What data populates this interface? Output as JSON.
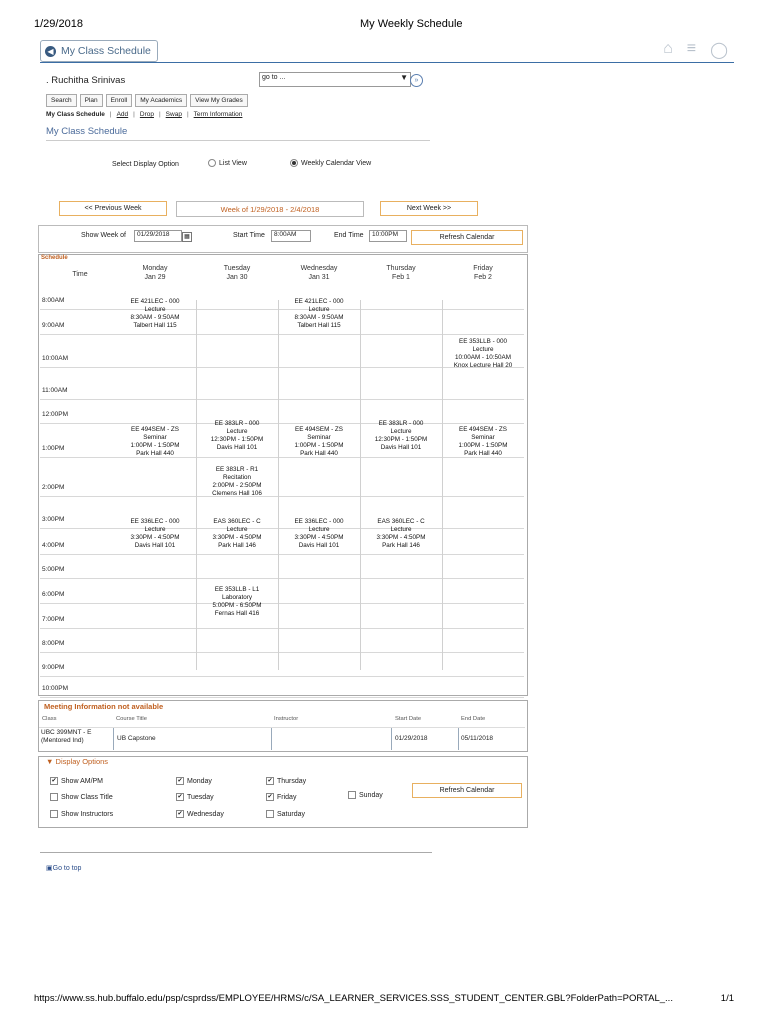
{
  "print_header": {
    "date": "1/29/2018",
    "title": "My Weekly Schedule"
  },
  "back_button": "My Class Schedule",
  "student_name": ". Ruchitha Srinivas",
  "goto": {
    "value": "go to ..."
  },
  "nav_buttons": [
    "Search",
    "Plan",
    "Enroll",
    "My Academics",
    "View My Grades"
  ],
  "sub_nav": [
    "My Class Schedule",
    "Add",
    "Drop",
    "Swap",
    "Term Information"
  ],
  "page_title": "My Class Schedule",
  "display_option": {
    "label": "Select Display Option",
    "list_view": "List View",
    "weekly_view": "Weekly Calendar View",
    "selected": "weekly"
  },
  "week_nav": {
    "prev": "<< Previous Week",
    "current": "Week of 1/29/2018 - 2/4/2018",
    "next": "Next Week >>"
  },
  "controls": {
    "show_week_label": "Show Week of",
    "show_week_value": "01/29/2018",
    "start_label": "Start Time",
    "start_value": "8:00AM",
    "end_label": "End Time",
    "end_value": "10:00PM",
    "refresh": "Refresh Calendar"
  },
  "schedule": {
    "label": "Schedule",
    "time_header": "Time",
    "days": [
      {
        "name": "Monday",
        "date": "Jan 29"
      },
      {
        "name": "Tuesday",
        "date": "Jan 30"
      },
      {
        "name": "Wednesday",
        "date": "Jan 31"
      },
      {
        "name": "Thursday",
        "date": "Feb 1"
      },
      {
        "name": "Friday",
        "date": "Feb 2"
      }
    ],
    "times": [
      "8:00AM",
      "9:00AM",
      "10:00AM",
      "11:00AM",
      "12:00PM",
      "1:00PM",
      "2:00PM",
      "3:00PM",
      "4:00PM",
      "5:00PM",
      "6:00PM",
      "7:00PM",
      "8:00PM",
      "9:00PM",
      "10:00PM"
    ],
    "events": [
      {
        "day": 0,
        "l1": "EE 421LEC - 000",
        "l2": "Lecture",
        "l3": "8:30AM - 9:50AM",
        "l4": "Talbert Hall 115"
      },
      {
        "day": 2,
        "l1": "EE 421LEC - 000",
        "l2": "Lecture",
        "l3": "8:30AM - 9:50AM",
        "l4": "Talbert Hall 115"
      },
      {
        "day": 4,
        "l1": "EE 353LLB - 000",
        "l2": "Lecture",
        "l3": "10:00AM - 10:50AM",
        "l4": "Knox Lecture Hall 20"
      },
      {
        "day": 1,
        "l1": "EE 383LR - 000",
        "l2": "Lecture",
        "l3": "12:30PM - 1:50PM",
        "l4": "Davis Hall 101"
      },
      {
        "day": 3,
        "l1": "EE 383LR - 000",
        "l2": "Lecture",
        "l3": "12:30PM - 1:50PM",
        "l4": "Davis Hall 101"
      },
      {
        "day": 0,
        "l1": "EE 494SEM - ZS",
        "l2": "Seminar",
        "l3": "1:00PM - 1:50PM",
        "l4": "Park Hall 440"
      },
      {
        "day": 2,
        "l1": "EE 494SEM - ZS",
        "l2": "Seminar",
        "l3": "1:00PM - 1:50PM",
        "l4": "Park Hall 440"
      },
      {
        "day": 4,
        "l1": "EE 494SEM - ZS",
        "l2": "Seminar",
        "l3": "1:00PM - 1:50PM",
        "l4": "Park Hall 440"
      },
      {
        "day": 1,
        "l1": "EE 383LR - R1",
        "l2": "Recitation",
        "l3": "2:00PM - 2:50PM",
        "l4": "Clemens Hall 106"
      },
      {
        "day": 0,
        "l1": "EE 336LEC - 000",
        "l2": "Lecture",
        "l3": "3:30PM - 4:50PM",
        "l4": "Davis Hall 101"
      },
      {
        "day": 1,
        "l1": "EAS 360LEC - C",
        "l2": "Lecture",
        "l3": "3:30PM - 4:50PM",
        "l4": "Park Hall 146"
      },
      {
        "day": 2,
        "l1": "EE 336LEC - 000",
        "l2": "Lecture",
        "l3": "3:30PM - 4:50PM",
        "l4": "Davis Hall 101"
      },
      {
        "day": 3,
        "l1": "EAS 360LEC - C",
        "l2": "Lecture",
        "l3": "3:30PM - 4:50PM",
        "l4": "Park Hall 146"
      },
      {
        "day": 1,
        "l1": "EE 353LLB - L1",
        "l2": "Laboratory",
        "l3": "5:00PM - 6:50PM",
        "l4": "Fernas Hall 416"
      }
    ]
  },
  "meeting_info": {
    "title": "Meeting Information not available",
    "headers": [
      "Class",
      "Course Title",
      "Instructor",
      "Start Date",
      "End Date"
    ],
    "row": {
      "class": "UBC 399MNT - E (Mentored Ind)",
      "title": "UB Capstone",
      "instructor": "",
      "start": "01/29/2018",
      "end": "05/11/2018"
    }
  },
  "display_options": {
    "title": "Display Options",
    "items": [
      {
        "label": "Show AM/PM",
        "checked": true
      },
      {
        "label": "Show Class Title",
        "checked": false
      },
      {
        "label": "Show Instructors",
        "checked": false
      },
      {
        "label": "Monday",
        "checked": true
      },
      {
        "label": "Tuesday",
        "checked": true
      },
      {
        "label": "Wednesday",
        "checked": true
      },
      {
        "label": "Thursday",
        "checked": true
      },
      {
        "label": "Friday",
        "checked": true
      },
      {
        "label": "Saturday",
        "checked": false
      },
      {
        "label": "Sunday",
        "checked": false
      }
    ],
    "refresh": "Refresh Calendar"
  },
  "go_to_top": "Go to top",
  "footer": {
    "url": "https://www.ss.hub.buffalo.edu/psp/csprdss/EMPLOYEE/HRMS/c/SA_LEARNER_SERVICES.SSS_STUDENT_CENTER.GBL?FolderPath=PORTAL_...",
    "page": "1/1"
  },
  "colors": {
    "accent": "#c06020",
    "link": "#4a6a9a",
    "rule": "#3b6ea5"
  }
}
